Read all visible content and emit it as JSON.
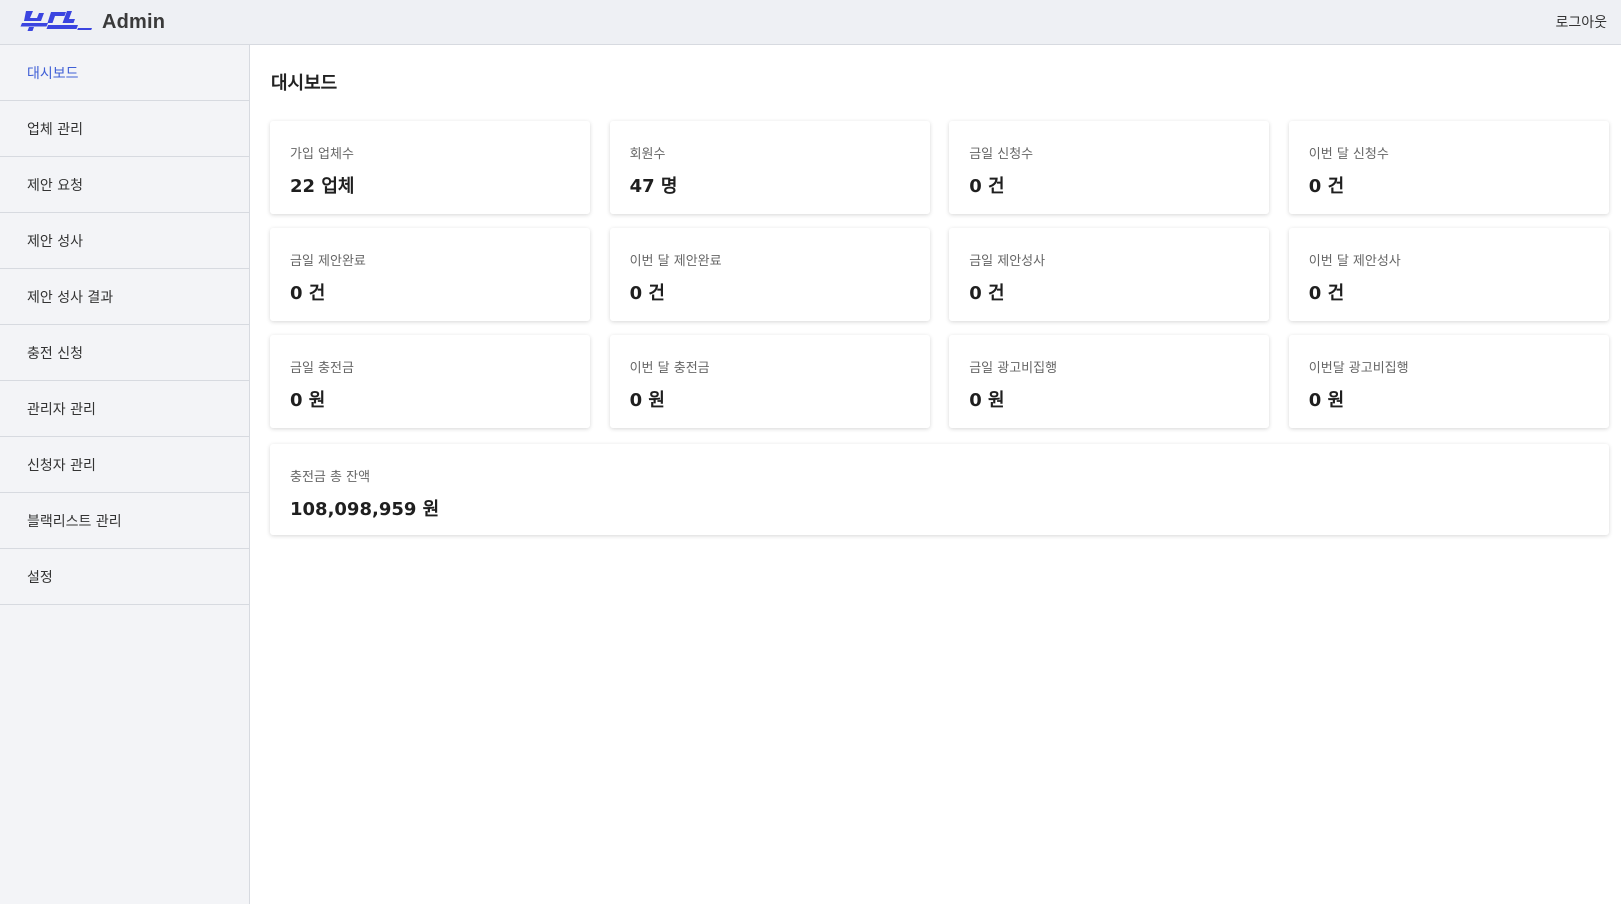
{
  "header": {
    "logo_text": "쏜다",
    "title": "Admin",
    "logout_label": "로그아웃",
    "brand_color": "#3b45e0"
  },
  "sidebar": {
    "active_color": "#3f5fd6",
    "items": [
      {
        "label": "대시보드",
        "active": true
      },
      {
        "label": "업체 관리"
      },
      {
        "label": "제안 요청"
      },
      {
        "label": "제안 성사"
      },
      {
        "label": "제안 성사 결과"
      },
      {
        "label": "충전 신청"
      },
      {
        "label": "관리자 관리"
      },
      {
        "label": "신청자 관리"
      },
      {
        "label": "블랙리스트 관리"
      },
      {
        "label": "설정"
      }
    ]
  },
  "main": {
    "title": "대시보드",
    "cards": [
      {
        "label": "가입 업체수",
        "value": "22 업체"
      },
      {
        "label": "회원수",
        "value": "47 명"
      },
      {
        "label": "금일 신청수",
        "value": "0 건"
      },
      {
        "label": "이번 달 신청수",
        "value": "0 건"
      },
      {
        "label": "금일 제안완료",
        "value": "0 건"
      },
      {
        "label": "이번 달 제안완료",
        "value": "0 건"
      },
      {
        "label": "금일 제안성사",
        "value": "0 건"
      },
      {
        "label": "이번 달 제안성사",
        "value": "0 건"
      },
      {
        "label": "금일 충전금",
        "value": "0 원"
      },
      {
        "label": "이번 달 충전금",
        "value": "0 원"
      },
      {
        "label": "금일 광고비집행",
        "value": "0 원"
      },
      {
        "label": "이번달 광고비집행",
        "value": "0 원"
      }
    ],
    "total_card": {
      "label": "충전금 총 잔액",
      "value": "108,098,959 원"
    }
  }
}
